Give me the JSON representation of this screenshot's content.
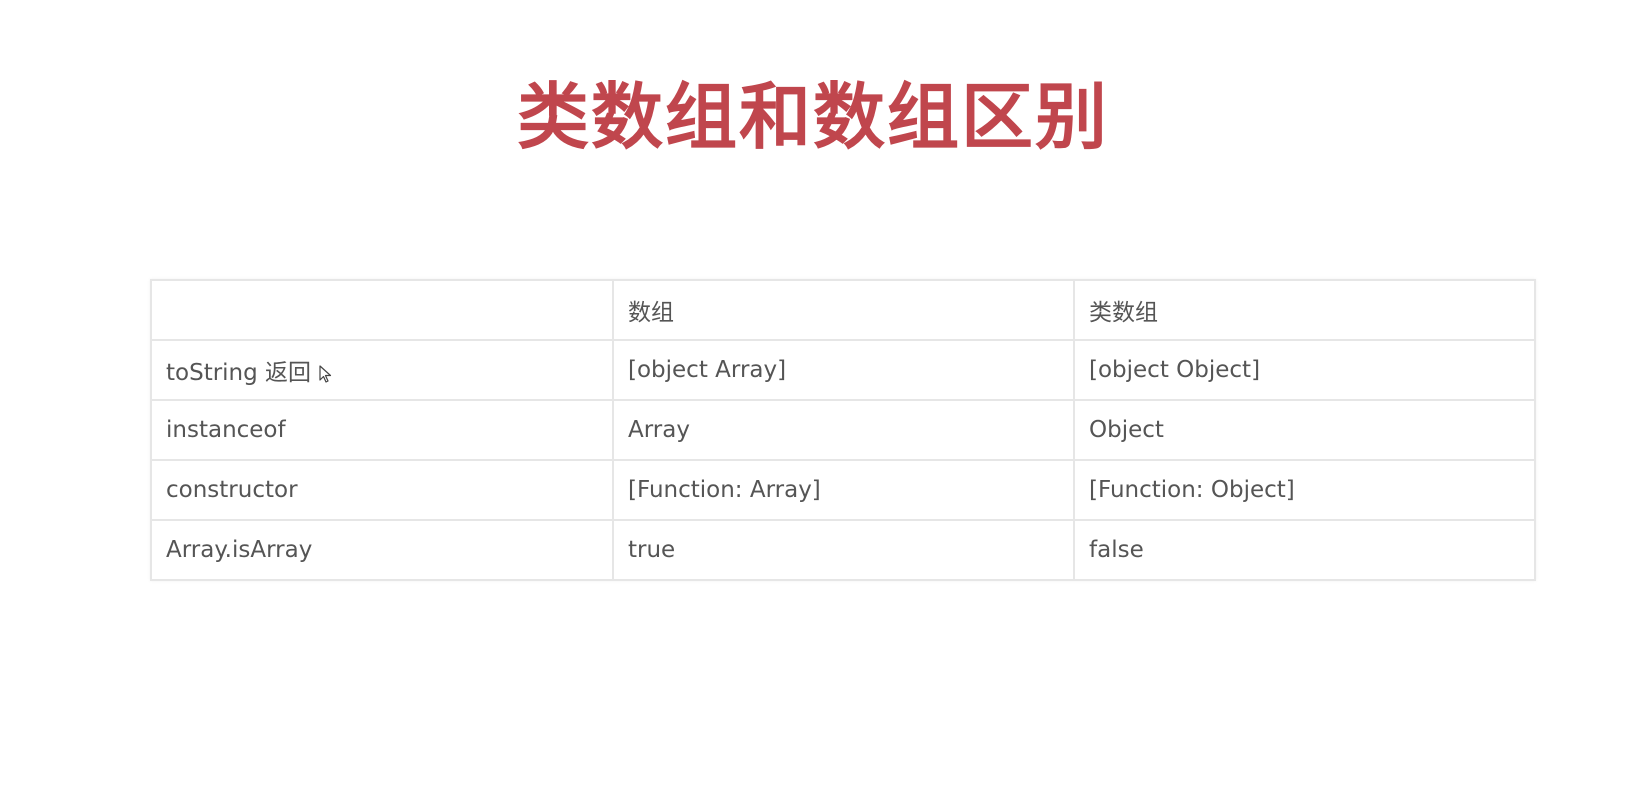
{
  "title": "类数组和数组区别",
  "table": {
    "header": [
      "",
      "数组",
      "类数组"
    ],
    "rows": [
      [
        "toString 返回",
        "[object Array]",
        "[object Object]"
      ],
      [
        "instanceof",
        "Array",
        "Object"
      ],
      [
        "constructor",
        "[Function: Array]",
        "[Function: Object]"
      ],
      [
        "Array.isArray",
        "true",
        "false"
      ]
    ]
  },
  "colors": {
    "title": "#c0464d",
    "border": "#e6e6e6",
    "text": "#555555"
  },
  "icons": {
    "cursor": "mouse-cursor-icon"
  }
}
